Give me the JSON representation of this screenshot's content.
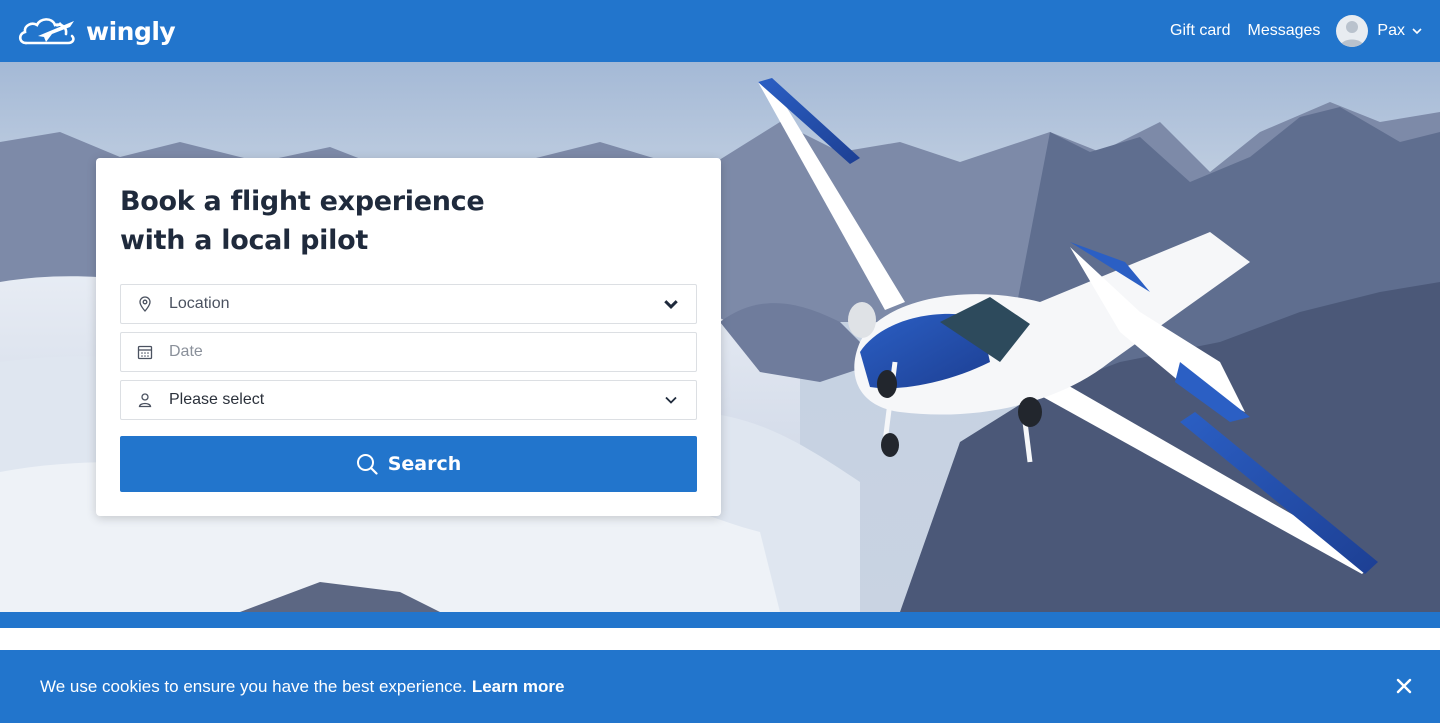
{
  "header": {
    "brand": "wingly",
    "nav": {
      "gift_card": "Gift card",
      "messages": "Messages"
    },
    "user": {
      "name": "Pax"
    }
  },
  "search_card": {
    "title_line1": "Book a flight experience",
    "title_line2": "with a local pilot",
    "location": {
      "placeholder": "Location",
      "icon": "map-pin-icon"
    },
    "date": {
      "placeholder": "Date",
      "icon": "calendar-icon"
    },
    "passengers": {
      "value": "Please select",
      "icon": "person-icon"
    },
    "search_label": "Search"
  },
  "cookie_banner": {
    "text": "We use cookies to ensure you have the best experience.",
    "link": "Learn more"
  },
  "colors": {
    "brand_blue": "#2275cc",
    "title": "#1f2a3c"
  }
}
